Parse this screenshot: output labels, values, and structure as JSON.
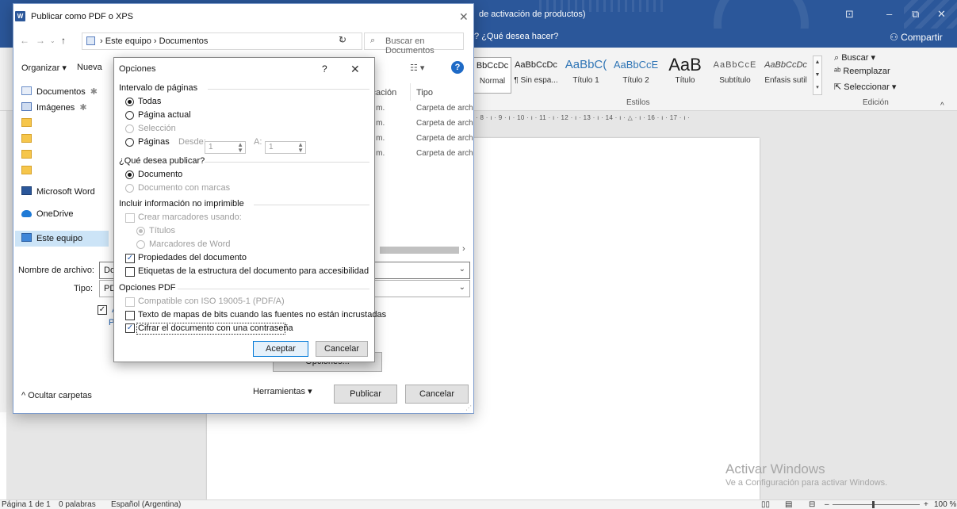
{
  "word": {
    "title_fragment": "de activación de productos)",
    "tell_me": "¿Qué desea hacer?",
    "share_button": "Compartir",
    "styles": [
      {
        "sample": "BbCcDc",
        "name": "Normal"
      },
      {
        "sample": "AaBbCcDc",
        "name": "¶ Sin espa..."
      },
      {
        "sample": "AaBbC(",
        "name": "Título 1"
      },
      {
        "sample": "AaBbCcE",
        "name": "Título 2"
      },
      {
        "sample": "AaB",
        "name": "Título"
      },
      {
        "sample": "AaBbCcE",
        "name": "Subtítulo"
      },
      {
        "sample": "AaBbCcDc",
        "name": "Énfasis sutil"
      }
    ],
    "styles_group_label": "Estilos",
    "editing": {
      "find": "Buscar",
      "replace": "Reemplazar",
      "select": "Seleccionar",
      "group_label": "Edición"
    },
    "ruler_text": "· 8 · ı · 9 · ı · 10 · ı · 11 · ı · 12 · ı · 13 · ı · 14 · ı · △ · ı · 16 · ı · 17 · ı ·",
    "watermark_title": "Activar Windows",
    "watermark_sub": "Ve a Configuración para activar Windows.",
    "status": {
      "page": "Página 1 de 1",
      "words": "0 palabras",
      "language": "Español (Argentina)",
      "zoom": "100 %"
    }
  },
  "save_dialog": {
    "title": "Publicar como PDF o XPS",
    "breadcrumb": [
      "Este equipo",
      "Documentos"
    ],
    "search_placeholder": "Buscar en Documentos",
    "organize": "Organizar ▾",
    "new_folder": "Nueva",
    "nav_items": [
      {
        "label": "Documentos",
        "icon": "documents-icon"
      },
      {
        "label": "Imágenes",
        "icon": "pictures-icon"
      },
      {
        "label": "",
        "icon": "folder-icon"
      },
      {
        "label": "",
        "icon": "folder-icon"
      },
      {
        "label": "",
        "icon": "folder-icon"
      },
      {
        "label": "",
        "icon": "folder-icon"
      },
      {
        "label": "Microsoft Word",
        "icon": "word-icon"
      },
      {
        "label": "OneDrive",
        "icon": "onedrive-icon"
      },
      {
        "label": "Este equipo",
        "icon": "this-pc-icon"
      }
    ],
    "columns": {
      "location": "ficación",
      "type": "Tipo"
    },
    "rows": [
      {
        "time": "p. m.",
        "type": "Carpeta de archi"
      },
      {
        "time": "p. m.",
        "type": "Carpeta de archi"
      },
      {
        "time": "p. m.",
        "type": "Carpeta de archi"
      },
      {
        "time": "a. m.",
        "type": "Carpeta de archi"
      }
    ],
    "filename_label": "Nombre de archivo:",
    "filename_value": "Do",
    "type_label": "Tipo:",
    "type_value": "PDF",
    "open_after_text": "A",
    "open_after_text2": "P",
    "right_frag1": "ón",
    "right_frag2": ")",
    "right_frag3": "a)",
    "options_button": "Opciones...",
    "hide_folders": "Ocultar carpetas",
    "tools": "Herramientas",
    "publish": "Publicar",
    "cancel": "Cancelar"
  },
  "options_dialog": {
    "title": "Opciones",
    "help": "?",
    "page_range": {
      "header": "Intervalo de páginas",
      "all": "Todas",
      "current": "Página actual",
      "selection": "Selección",
      "pages": "Páginas",
      "from_label": "Desde:",
      "from_value": "1",
      "to_label": "A:",
      "to_value": "1",
      "selected": "all"
    },
    "publish_what": {
      "header": "¿Qué desea publicar?",
      "document": "Documento",
      "document_markup": "Documento con marcas",
      "selected": "document"
    },
    "non_printing": {
      "header": "Incluir información no imprimible",
      "create_bookmarks": "Crear marcadores usando:",
      "headings": "Títulos",
      "word_bookmarks": "Marcadores de Word",
      "doc_properties": "Propiedades del documento",
      "doc_properties_checked": true,
      "structure_tags": "Etiquetas de la estructura del documento para accesibilidad",
      "structure_tags_checked": false
    },
    "pdf_options": {
      "header": "Opciones PDF",
      "iso": "Compatible con ISO 19005-1 (PDF/A)",
      "bitmap_text": "Texto de mapas de bits cuando las fuentes no están incrustadas",
      "bitmap_text_checked": false,
      "encrypt": "Cifrar el documento con una contraseña",
      "encrypt_checked": true
    },
    "accept": "Aceptar",
    "cancel": "Cancelar"
  }
}
